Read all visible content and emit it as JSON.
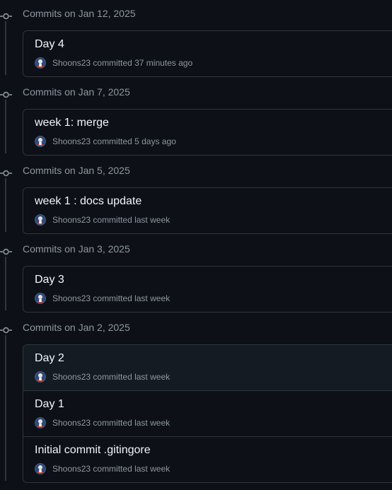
{
  "colors": {
    "background": "#0d1117",
    "border": "#30363d",
    "muted_text": "#8d96a0",
    "primary_text": "#f0f6fc",
    "highlight_row": "#151b23"
  },
  "icons": {
    "group_marker": "git-commit-icon",
    "author_avatar": "avatar"
  },
  "groups": [
    {
      "title": "Commits on Jan 12, 2025",
      "commits": [
        {
          "message": "Day 4",
          "author": "Shoons23",
          "action": "committed",
          "time": "37 minutes ago"
        }
      ]
    },
    {
      "title": "Commits on Jan 7, 2025",
      "commits": [
        {
          "message": "week 1: merge",
          "author": "Shoons23",
          "action": "committed",
          "time": "5 days ago"
        }
      ]
    },
    {
      "title": "Commits on Jan 5, 2025",
      "commits": [
        {
          "message": "week 1 : docs update",
          "author": "Shoons23",
          "action": "committed",
          "time": "last week"
        }
      ]
    },
    {
      "title": "Commits on Jan 3, 2025",
      "commits": [
        {
          "message": "Day 3",
          "author": "Shoons23",
          "action": "committed",
          "time": "last week"
        }
      ]
    },
    {
      "title": "Commits on Jan 2, 2025",
      "commits": [
        {
          "message": "Day 2",
          "author": "Shoons23",
          "action": "committed",
          "time": "last week"
        },
        {
          "message": "Day 1",
          "author": "Shoons23",
          "action": "committed",
          "time": "last week"
        },
        {
          "message": "Initial commit .gitingore",
          "author": "Shoons23",
          "action": "committed",
          "time": "last week"
        }
      ]
    }
  ]
}
